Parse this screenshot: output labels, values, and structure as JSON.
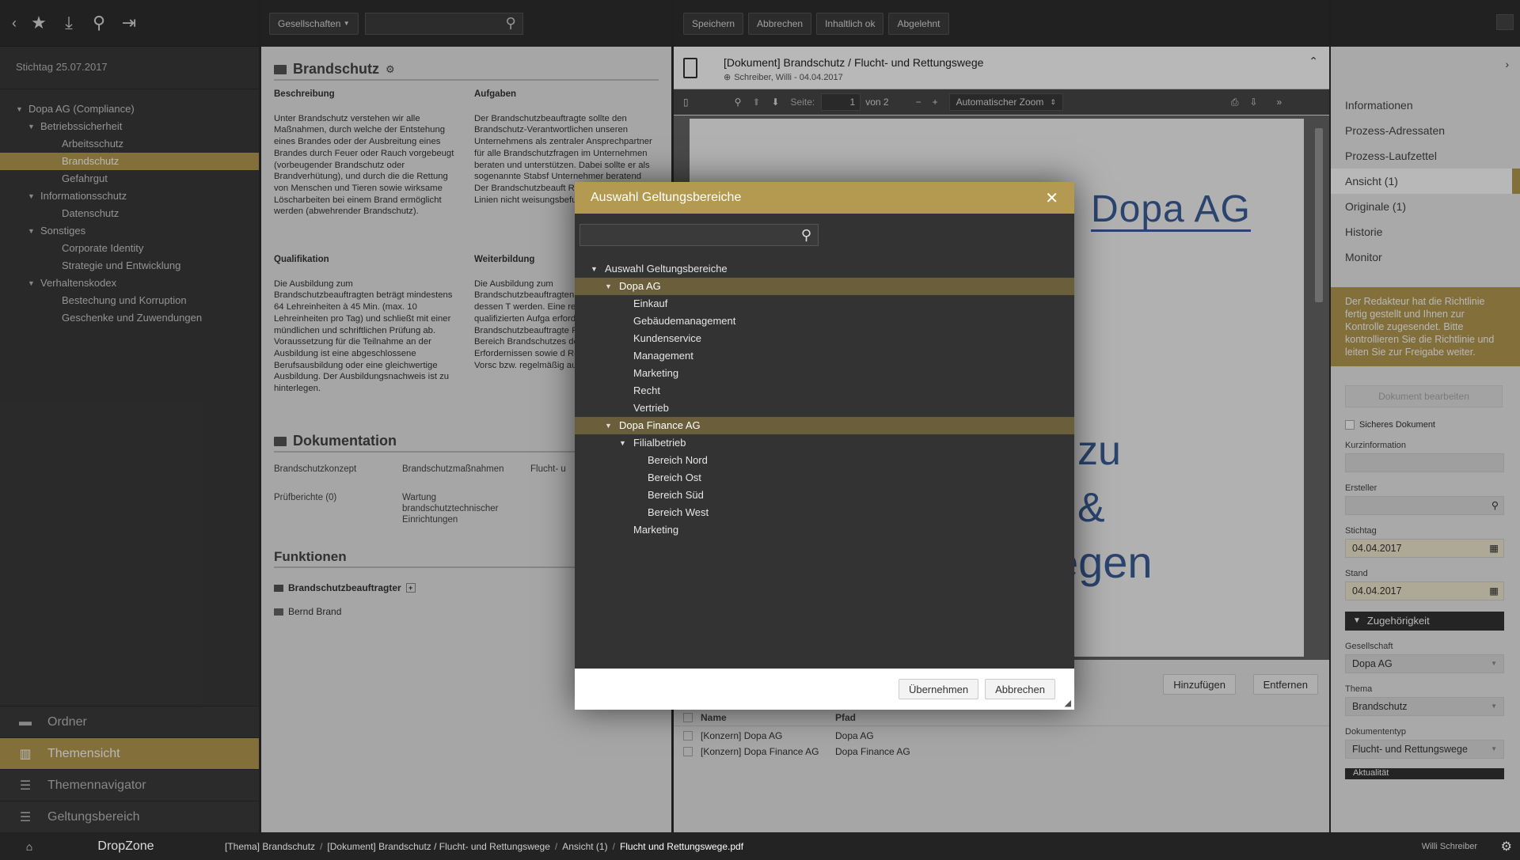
{
  "left": {
    "stichtag": "Stichtag 25.07.2017",
    "tree": [
      {
        "label": "Dopa AG (Compliance)",
        "level": 0,
        "caret": true,
        "selected": false
      },
      {
        "label": "Betriebssicherheit",
        "level": 1,
        "caret": true,
        "selected": false
      },
      {
        "label": "Arbeitsschutz",
        "level": 2,
        "caret": false,
        "selected": false
      },
      {
        "label": "Brandschutz",
        "level": 2,
        "caret": false,
        "selected": true
      },
      {
        "label": "Gefahrgut",
        "level": 2,
        "caret": false,
        "selected": false
      },
      {
        "label": "Informationsschutz",
        "level": 1,
        "caret": true,
        "selected": false
      },
      {
        "label": "Datenschutz",
        "level": 2,
        "caret": false,
        "selected": false
      },
      {
        "label": "Sonstiges",
        "level": 1,
        "caret": true,
        "selected": false
      },
      {
        "label": "Corporate Identity",
        "level": 2,
        "caret": false,
        "selected": false
      },
      {
        "label": "Strategie und Entwicklung",
        "level": 2,
        "caret": false,
        "selected": false
      },
      {
        "label": "Verhaltenskodex",
        "level": 1,
        "caret": true,
        "selected": false
      },
      {
        "label": "Bestechung und Korruption",
        "level": 2,
        "caret": false,
        "selected": false
      },
      {
        "label": "Geschenke und Zuwendungen",
        "level": 2,
        "caret": false,
        "selected": false
      }
    ],
    "bottom_nav": [
      {
        "label": "Ordner",
        "icon": "folder-icon",
        "glyph": "▬",
        "selected": false
      },
      {
        "label": "Themensicht",
        "icon": "building-icon",
        "glyph": "▥",
        "selected": true
      },
      {
        "label": "Themennavigator",
        "icon": "list-icon",
        "glyph": "☰",
        "selected": false
      },
      {
        "label": "Geltungsbereich",
        "icon": "list-icon",
        "glyph": "☰",
        "selected": false
      }
    ]
  },
  "mid": {
    "company_dropdown": "Gesellschaften",
    "title": "Brandschutz",
    "beschreibung_label": "Beschreibung",
    "beschreibung_text": "Unter Brandschutz verstehen wir alle Maßnahmen, durch welche der Entstehung eines Brandes oder der Ausbreitung eines Brandes durch Feuer oder Rauch vorgebeugt (vorbeugender Brandschutz oder Brandverhütung), und durch die die Rettung von Menschen und Tieren sowie wirksame Löscharbeiten bei einem Brand ermöglicht werden (abwehrender Brandschutz).",
    "aufgaben_label": "Aufgaben",
    "aufgaben_text": "Der Brandschutzbeauftragte sollte den Brandschutz-Verantwortlichen unseren Unternehmens als zentraler Ansprechpartner für alle Brandschutzfragen im Unternehmen beraten und unterstützen. Dabei sollte er als sogenannte Stabsf Unternehmer beratend Der Brandschutzbeauft Regel daher kein Linien nicht weisungsbefugt.",
    "qualifikation_label": "Qualifikation",
    "qualifikation_text": "Die Ausbildung zum Brandschutzbeauftragten beträgt mindestens 64 Lehreinheiten à 45 Min. (max. 10 Lehreinheiten pro Tag) und schließt mit einer mündlichen und schriftlichen Prüfung ab. Voraussetzung für die Teilnahme an der Ausbildung ist eine abgeschlossene Berufsausbildung oder eine gleichwertige Ausbildung. Der Ausbildungsnachweis ist zu hinterlegen.",
    "weiterbildung_label": "Weiterbildung",
    "weiterbildung_text": "Die Ausbildung zum Brandschutzbeauftragten Grundlage für dessen T werden. Eine regelmä zur qualifizierten Aufga erforderlich. Daraus erg Brandschutzbeauftragte Fachkunde im Bereich Brandschutzes den akt Erfordernissen sowie d Regelwerken und Vorsc bzw. regelmäßig auffris",
    "doku_title": "Dokumentation",
    "doku_row1": [
      "Brandschutzkonzept",
      "Brandschutzmaßnahmen",
      "Flucht- u"
    ],
    "doku_row2": [
      "Prüfberichte (0)",
      "Wartung brandschutztechnischer Einrichtungen",
      ""
    ],
    "funktionen_title": "Funktionen",
    "funktion_name": "Brandschutzbeauftragter",
    "person": "Bernd Brand"
  },
  "viewer": {
    "buttons": [
      "Speichern",
      "Abbrechen",
      "Inhaltlich ok",
      "Abgelehnt"
    ],
    "doc_title": "[Dokument] Brandschutz / Flucht- und Rettungswege",
    "doc_meta": "Schreiber, Willi - 04.04.2017",
    "seite_label": "Seite:",
    "page_value": "1",
    "page_total": "von 2",
    "zoom": "Automatischer Zoom",
    "page_logo": "Dopa AG",
    "page_text1": "zu",
    "page_text2": "&",
    "page_text3": "egen",
    "hinzufuegen": "Hinzufügen",
    "entfernen": "Entfernen",
    "table_headers": [
      "Name",
      "Pfad"
    ],
    "table_rows": [
      [
        "[Konzern] Dopa AG",
        "Dopa AG"
      ],
      [
        "[Konzern] Dopa Finance AG",
        "Dopa Finance AG"
      ]
    ]
  },
  "rp": {
    "items": [
      {
        "label": "Informationen",
        "selected": false
      },
      {
        "label": "Prozess-Adressaten",
        "selected": false
      },
      {
        "label": "Prozess-Laufzettel",
        "selected": false
      },
      {
        "label": "Ansicht (1)",
        "selected": true
      },
      {
        "label": "Originale (1)",
        "selected": false
      },
      {
        "label": "Historie",
        "selected": false
      },
      {
        "label": "Monitor",
        "selected": false
      }
    ],
    "note": "Der Redakteur hat die Richtlinie fertig gestellt und Ihnen zur Kontrolle zugesendet. Bitte kontrollieren Sie die Richtlinie und leiten Sie zur Freigabe weiter.",
    "edit_button": "Dokument bearbeiten",
    "secure_label": "Sicheres Dokument",
    "kurzinfo_label": "Kurzinformation",
    "ersteller_label": "Ersteller",
    "stichtag_label": "Stichtag",
    "stichtag_value": "04.04.2017",
    "stand_label": "Stand",
    "stand_value": "04.04.2017",
    "zugehoerigkeit": "Zugehörigkeit",
    "gesellschaft_label": "Gesellschaft",
    "gesellschaft_value": "Dopa AG",
    "thema_label": "Thema",
    "thema_value": "Brandschutz",
    "doktyp_label": "Dokumententyp",
    "doktyp_value": "Flucht- und Rettungswege",
    "aktualitaet": "Aktualität"
  },
  "status": {
    "dropzone": "DropZone",
    "crumbs": [
      "[Thema] Brandschutz",
      "[Dokument] Brandschutz / Flucht- und Rettungswege",
      "Ansicht (1)",
      "Flucht und Rettungswege.pdf"
    ],
    "user": "Willi Schreiber"
  },
  "dialog": {
    "title": "Auswahl Geltungsbereiche",
    "tree": [
      {
        "label": "Auswahl Geltungsbereiche",
        "level": 0,
        "caret": true,
        "selected": false
      },
      {
        "label": "Dopa AG",
        "level": 1,
        "caret": true,
        "selected": true
      },
      {
        "label": "Einkauf",
        "level": 2,
        "caret": false,
        "selected": false
      },
      {
        "label": "Gebäudemanagement",
        "level": 2,
        "caret": false,
        "selected": false
      },
      {
        "label": "Kundenservice",
        "level": 2,
        "caret": false,
        "selected": false
      },
      {
        "label": "Management",
        "level": 2,
        "caret": false,
        "selected": false
      },
      {
        "label": "Marketing",
        "level": 2,
        "caret": false,
        "selected": false
      },
      {
        "label": "Recht",
        "level": 2,
        "caret": false,
        "selected": false
      },
      {
        "label": "Vertrieb",
        "level": 2,
        "caret": false,
        "selected": false
      },
      {
        "label": "Dopa Finance AG",
        "level": 1,
        "caret": true,
        "selected": true
      },
      {
        "label": "Filialbetrieb",
        "level": 2,
        "caret": true,
        "selected": false
      },
      {
        "label": "Bereich Nord",
        "level": 3,
        "caret": false,
        "selected": false
      },
      {
        "label": "Bereich Ost",
        "level": 3,
        "caret": false,
        "selected": false
      },
      {
        "label": "Bereich Süd",
        "level": 3,
        "caret": false,
        "selected": false
      },
      {
        "label": "Bereich West",
        "level": 3,
        "caret": false,
        "selected": false
      },
      {
        "label": "Marketing",
        "level": 2,
        "caret": false,
        "selected": false
      }
    ],
    "ok_button": "Übernehmen",
    "cancel_button": "Abbrechen"
  }
}
